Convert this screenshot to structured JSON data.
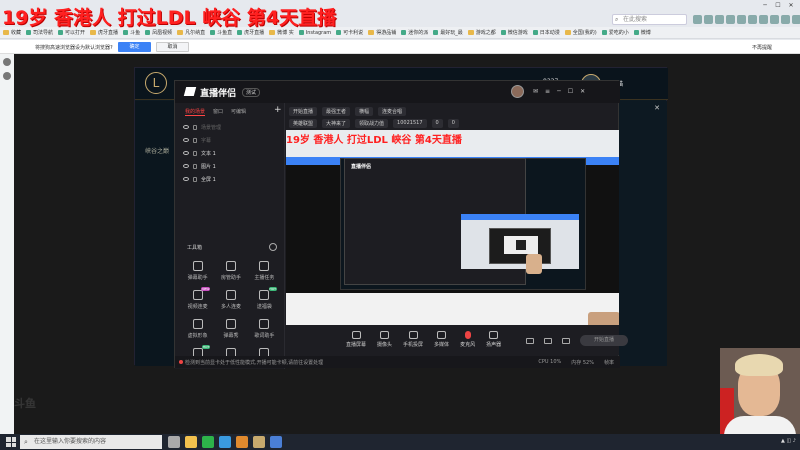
{
  "stream_title": "19岁 香港人 打过LDL 峡谷 第4天直播",
  "browser": {
    "search_placeholder": "在此搜索",
    "bookmarks": [
      "收藏",
      "司法导航",
      "可以打开",
      "虎牙直播",
      "斗鱼",
      "凤凰视频",
      "凡尔纳直",
      "斗鱼直",
      "虎牙直播",
      "微博 实",
      "Instagram",
      "可卡利说",
      "得游品铺",
      "迷你的派",
      "最好玩_最",
      "游戏之都",
      "微信游戏",
      "日本动漫",
      "全国(我的)",
      "爱吃的小",
      "微博"
    ],
    "more_bookmarks": "不再提醒"
  },
  "notify": {
    "text": "将搜狗高速浏览器设为默认浏览器?",
    "ok": "确定",
    "cancel": "取消",
    "check": "不再提醒"
  },
  "lol": {
    "rp": "8337",
    "name": "爱吃猫",
    "side_label": "峡谷之巅"
  },
  "app": {
    "logo": "直播伴侣",
    "badge": "测试",
    "tabs": [
      "我的场景",
      "窗口",
      "可编辑"
    ],
    "scenes": [
      {
        "label": "场景管理",
        "dim": true
      },
      {
        "label": "字幕",
        "dim": true
      },
      {
        "label": "文本 1",
        "dim": false
      },
      {
        "label": "图片 1",
        "dim": false
      },
      {
        "label": "全屏 1",
        "dim": false
      }
    ],
    "info_row1": [
      "开始直播",
      "最强王者",
      "横幅",
      "连麦合唱"
    ],
    "info_row2": [
      "英雄联盟",
      "大神来了",
      "领取战力值",
      "10021517",
      "0",
      "0"
    ],
    "tools_title": "工具箱",
    "tools": [
      {
        "label": "弹幕助手",
        "badge": ""
      },
      {
        "label": "房管助手",
        "badge": ""
      },
      {
        "label": "主播任务",
        "badge": ""
      },
      {
        "label": "视频连麦",
        "badge": "NEW"
      },
      {
        "label": "多人连麦",
        "badge": ""
      },
      {
        "label": "送福袋",
        "badge": "HOT"
      },
      {
        "label": "虚拟形象",
        "badge": ""
      },
      {
        "label": "弹幕秀",
        "badge": ""
      },
      {
        "label": "歌词助手",
        "badge": ""
      },
      {
        "label": "",
        "badge": "HOT"
      },
      {
        "label": "",
        "badge": ""
      },
      {
        "label": "",
        "badge": ""
      }
    ],
    "bottom": [
      "直播屏幕",
      "摄像头",
      "手机投屏",
      "多媒体",
      "麦克风",
      "扬声器"
    ],
    "start_label": "开始直播",
    "status_msg": "检测到当前显卡处于低性能模式,开播可能卡顿,请前往设置处理",
    "status_right": [
      "CPU 10%",
      "内存 52%",
      "帧率"
    ]
  },
  "taskbar": {
    "search_placeholder": "在这里输入你要搜索的内容"
  },
  "colors": {
    "title_red": "#ff2020",
    "accent_blue": "#3b82f6"
  }
}
